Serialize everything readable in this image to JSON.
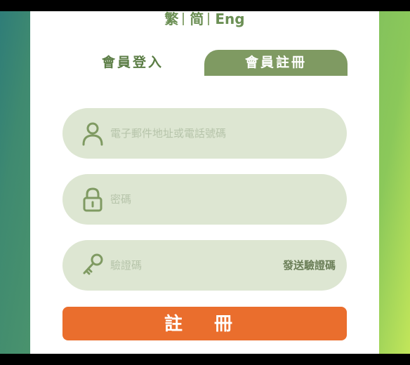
{
  "languages": [
    "繁",
    "简",
    "Eng"
  ],
  "tabs": {
    "login": "會員登入",
    "register": "會員註冊"
  },
  "form": {
    "email_placeholder": "電子郵件地址或電話號碼",
    "password_placeholder": "密碼",
    "code_placeholder": "驗證碼",
    "send_code": "發送驗證碼",
    "submit": "註 冊"
  },
  "colors": {
    "accent_green": "#7f9a62",
    "field_bg": "#dde6d2",
    "submit_orange": "#ea6e2d",
    "text_green": "#6b8f54"
  },
  "icons": {
    "email": "user-icon",
    "password": "lock-icon",
    "code": "key-icon"
  }
}
